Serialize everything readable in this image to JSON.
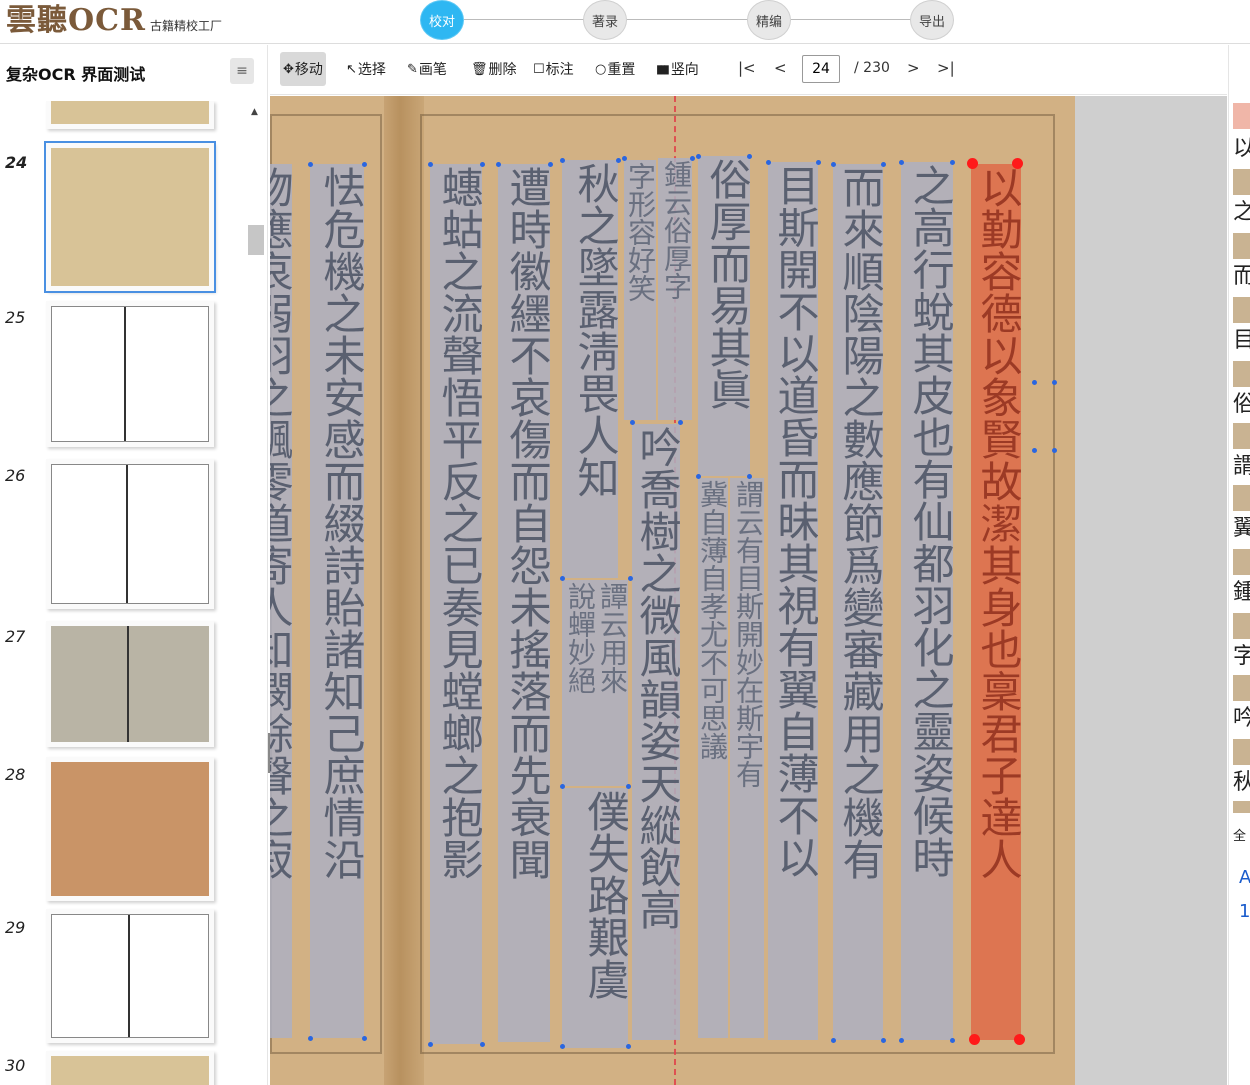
{
  "header": {
    "logo_main": "雲聽OCR",
    "logo_sub": "古籍精校工厂",
    "steps": [
      {
        "label": "校对",
        "active": true
      },
      {
        "label": "著录",
        "active": false
      },
      {
        "label": "精编",
        "active": false
      },
      {
        "label": "导出",
        "active": false
      }
    ]
  },
  "sidebar": {
    "title": "复杂OCR 界面测试",
    "menu_icon": "≡",
    "thumbnails": [
      {
        "num": "24",
        "selected": true,
        "style": "tan"
      },
      {
        "num": "25",
        "selected": false,
        "style": "white"
      },
      {
        "num": "26",
        "selected": false,
        "style": "white"
      },
      {
        "num": "27",
        "selected": false,
        "style": "grey"
      },
      {
        "num": "28",
        "selected": false,
        "style": "brown"
      },
      {
        "num": "29",
        "selected": false,
        "style": "white"
      },
      {
        "num": "30",
        "selected": false,
        "style": "tan"
      }
    ]
  },
  "toolbar": {
    "tools": [
      {
        "icon": "✥",
        "label": "移动",
        "active": true
      },
      {
        "icon": "↖",
        "label": "选择",
        "active": false
      },
      {
        "icon": "✎",
        "label": "画笔",
        "active": false
      },
      {
        "icon": "🗑",
        "label": "删除",
        "active": false
      },
      {
        "icon": "☐",
        "label": "标注",
        "active": false
      },
      {
        "icon": "○",
        "label": "重置",
        "active": false
      },
      {
        "icon": "▮▮▮",
        "label": "竖向",
        "active": false
      }
    ],
    "first_icon": "|<",
    "prev_icon": "<",
    "next_icon": ">",
    "last_icon": ">|",
    "page_current": "24",
    "page_total": "/ 230"
  },
  "canvas": {
    "columns": [
      {
        "id": "c1",
        "text": "以勤容德以象賢故潔其身也稟君子達人",
        "selected": true
      },
      {
        "id": "c2",
        "text": "之高行蛻其皮也有仙都羽化之靈姿候時",
        "selected": false
      },
      {
        "id": "c3",
        "text": "而來順陰陽之數應節爲變審藏用之機有",
        "selected": false
      },
      {
        "id": "c4",
        "text": "目斯開不以道昏而昧其視有翼自薄不以",
        "selected": false
      },
      {
        "id": "c5",
        "text": "俗厚而易其眞",
        "selected": false
      },
      {
        "id": "c6",
        "text": "冀自薄自孝尤不可思議",
        "selected": false,
        "small": true
      },
      {
        "id": "c7",
        "text": "謂云有目斯開妙在斯宇有",
        "selected": false,
        "small": true
      },
      {
        "id": "c8",
        "text": "鍾云俗厚字",
        "selected": false,
        "small": true
      },
      {
        "id": "c9",
        "text": "字形容好笑",
        "selected": false,
        "small": true
      },
      {
        "id": "c10",
        "text": "吟喬樹之微風韻姿天縱飲高",
        "selected": false
      },
      {
        "id": "c11",
        "text": "秋之墜露淸畏人知",
        "selected": false
      },
      {
        "id": "c12",
        "text": "說蟬妙絕",
        "selected": false,
        "small": true
      },
      {
        "id": "c13",
        "text": "譚云用來",
        "selected": false,
        "small": true
      },
      {
        "id": "c14",
        "text": "僕失路艱虞",
        "selected": false
      },
      {
        "id": "c15",
        "text": "遭時徽纆不哀傷而自怨未搖落而先衰聞",
        "selected": false
      },
      {
        "id": "c16",
        "text": "蟪蛄之流聲悟平反之已奏見螳螂之抱影",
        "selected": false
      },
      {
        "id": "c17",
        "text": "怯危機之未安感而綴詩貽諸知己庶情沿",
        "selected": false
      },
      {
        "id": "c18",
        "text": "物應哀弱羽之飄零道寄人知憫餘聲之寂",
        "selected": false
      }
    ]
  },
  "right_panel": {
    "rows": [
      {
        "text": "以",
        "highlight": true
      },
      {
        "text": "之",
        "highlight": false
      },
      {
        "text": "而",
        "highlight": false
      },
      {
        "text": "目",
        "highlight": false
      },
      {
        "text": "俗",
        "highlight": false
      },
      {
        "text": "謂",
        "highlight": false
      },
      {
        "text": "翼",
        "highlight": false
      },
      {
        "text": "鍾",
        "highlight": false
      },
      {
        "text": "字",
        "highlight": false
      },
      {
        "text": "吟",
        "highlight": false
      },
      {
        "text": "秋",
        "highlight": false
      }
    ],
    "footer_text": "全",
    "link_a": "A",
    "link_1": "1"
  },
  "colors": {
    "accent": "#2eb7f2",
    "selected_box": "#de6c4a",
    "box": "#adb0c0",
    "handle": "#2a66e0"
  }
}
